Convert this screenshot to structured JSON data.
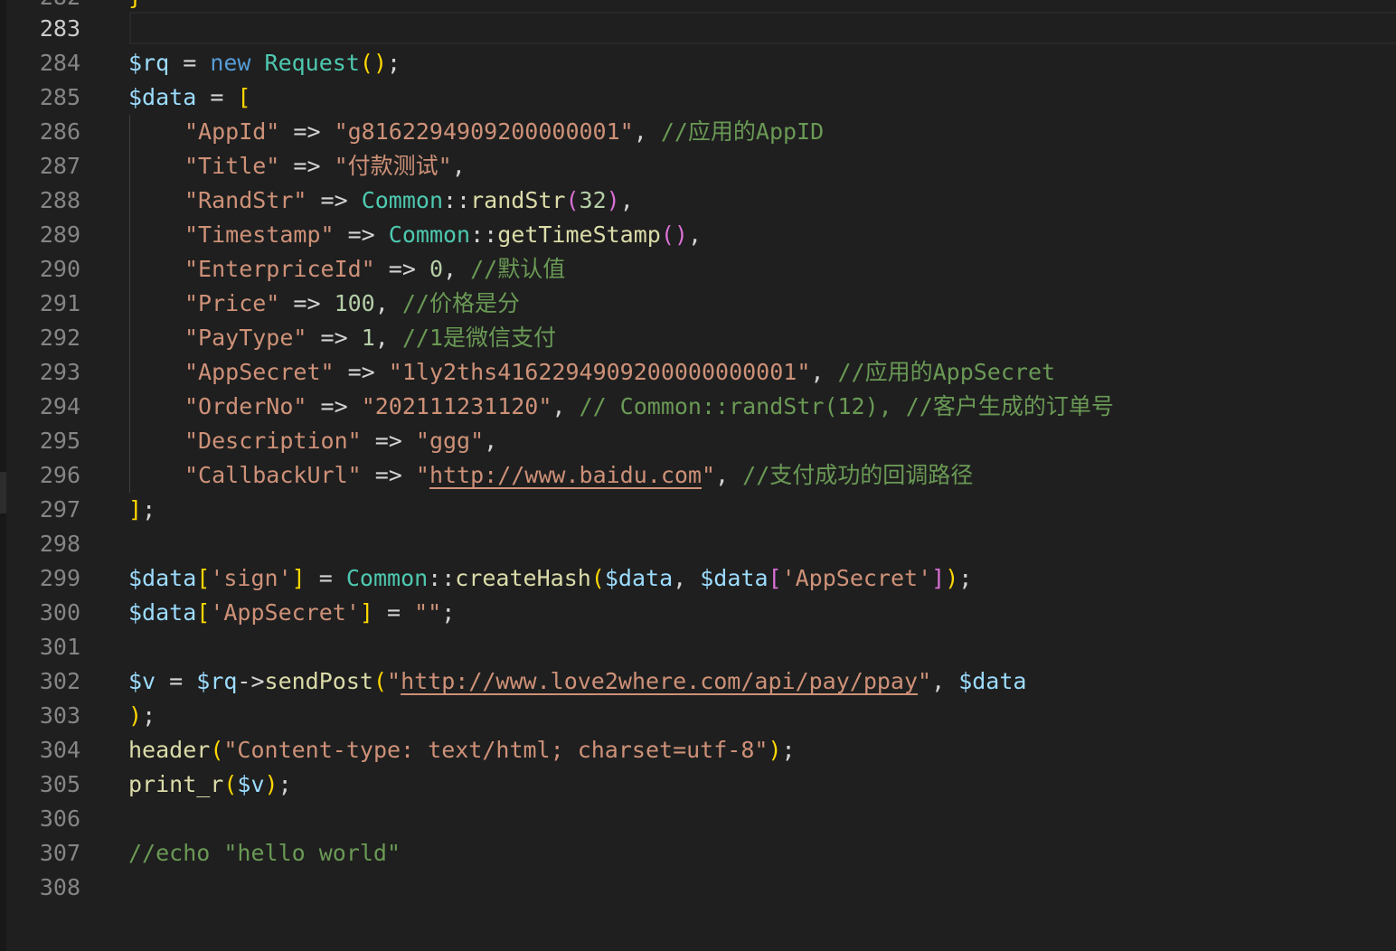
{
  "editor": {
    "partial_top_line_number": "282",
    "partial_top_code": "}",
    "active_line": "283",
    "line_numbers": [
      "283",
      "284",
      "285",
      "286",
      "287",
      "288",
      "289",
      "290",
      "291",
      "292",
      "293",
      "294",
      "295",
      "296",
      "297",
      "298",
      "299",
      "300",
      "301",
      "302",
      "303",
      "304",
      "305",
      "306",
      "307",
      "308"
    ],
    "lines": {
      "l284": {
        "v": "$rq",
        "eq": " = ",
        "kw": "new",
        "cls": "Request",
        "p": "()",
        "end": ";"
      },
      "l285": {
        "v": "$data",
        "eq": " = ",
        "b": "["
      },
      "l286": {
        "key": "\"AppId\"",
        "arrow": " => ",
        "val": "\"g8162294909200000001\"",
        "comma": ", ",
        "cm": "//应用的AppID"
      },
      "l287": {
        "key": "\"Title\"",
        "arrow": " => ",
        "val": "\"付款测试\"",
        "comma": ","
      },
      "l288": {
        "key": "\"RandStr\"",
        "arrow": " => ",
        "cls": "Common",
        "sep": "::",
        "fn": "randStr",
        "po": "(",
        "num": "32",
        "pc": ")",
        "comma": ","
      },
      "l289": {
        "key": "\"Timestamp\"",
        "arrow": " => ",
        "cls": "Common",
        "sep": "::",
        "fn": "getTimeStamp",
        "p": "()",
        "comma": ","
      },
      "l290": {
        "key": "\"EnterpriceId\"",
        "arrow": " => ",
        "num": "0",
        "comma": ", ",
        "cm": "//默认值"
      },
      "l291": {
        "key": "\"Price\"",
        "arrow": " => ",
        "num": "100",
        "comma": ", ",
        "cm": "//价格是分"
      },
      "l292": {
        "key": "\"PayType\"",
        "arrow": " => ",
        "num": "1",
        "comma": ", ",
        "cm": "//1是微信支付"
      },
      "l293": {
        "key": "\"AppSecret\"",
        "arrow": " => ",
        "val": "\"1ly2ths4162294909200000000001\"",
        "comma": ", ",
        "cm": "//应用的AppSecret"
      },
      "l294": {
        "key": "\"OrderNo\"",
        "arrow": " => ",
        "val": "\"202111231120\"",
        "comma": ", ",
        "cm": "// Common::randStr(12), //客户生成的订单号"
      },
      "l295": {
        "key": "\"Description\"",
        "arrow": " => ",
        "val": "\"ggg\"",
        "comma": ","
      },
      "l296": {
        "key": "\"CallbackUrl\"",
        "arrow": " => ",
        "q1": "\"",
        "url": "http://www.baidu.com",
        "q2": "\"",
        "comma": ", ",
        "cm": "//支付成功的回调路径"
      },
      "l297": {
        "b": "]",
        "end": ";"
      },
      "l299": {
        "v": "$data",
        "bo": "[",
        "k": "'sign'",
        "bc": "]",
        "eq": " = ",
        "cls": "Common",
        "sep": "::",
        "fn": "createHash",
        "po": "(",
        "a1": "$data",
        "c": ", ",
        "a2": "$data",
        "bo2": "[",
        "k2": "'AppSecret'",
        "bc2": "]",
        "pc": ")",
        "end": ";"
      },
      "l300": {
        "v": "$data",
        "bo": "[",
        "k": "'AppSecret'",
        "bc": "]",
        "eq": " = ",
        "val": "\"\"",
        "end": ";"
      },
      "l302": {
        "v": "$v",
        "eq": " = ",
        "v2": "$rq",
        "arrow": "->",
        "fn": "sendPost",
        "po": "(",
        "q1": "\"",
        "url": "http://www.love2where.com/api/pay/ppay",
        "q2": "\"",
        "c": ", ",
        "a": "$data"
      },
      "l303": {
        "pc": ")",
        "end": ";"
      },
      "l304": {
        "fn": "header",
        "po": "(",
        "val": "\"Content-type: text/html; charset=utf-8\"",
        "pc": ")",
        "end": ";"
      },
      "l305": {
        "fn": "print_r",
        "po": "(",
        "a": "$v",
        "pc": ")",
        "end": ";"
      },
      "l307": {
        "cm": "//echo \"hello world\""
      }
    }
  },
  "colors": {
    "background": "#1f1f1f",
    "line_number": "#858585",
    "variable": "#9cdcfe",
    "keyword": "#569cd6",
    "class": "#4ec9b0",
    "function": "#dcdcaa",
    "string": "#ce9178",
    "comment": "#6a9955",
    "number": "#b5cea8"
  }
}
